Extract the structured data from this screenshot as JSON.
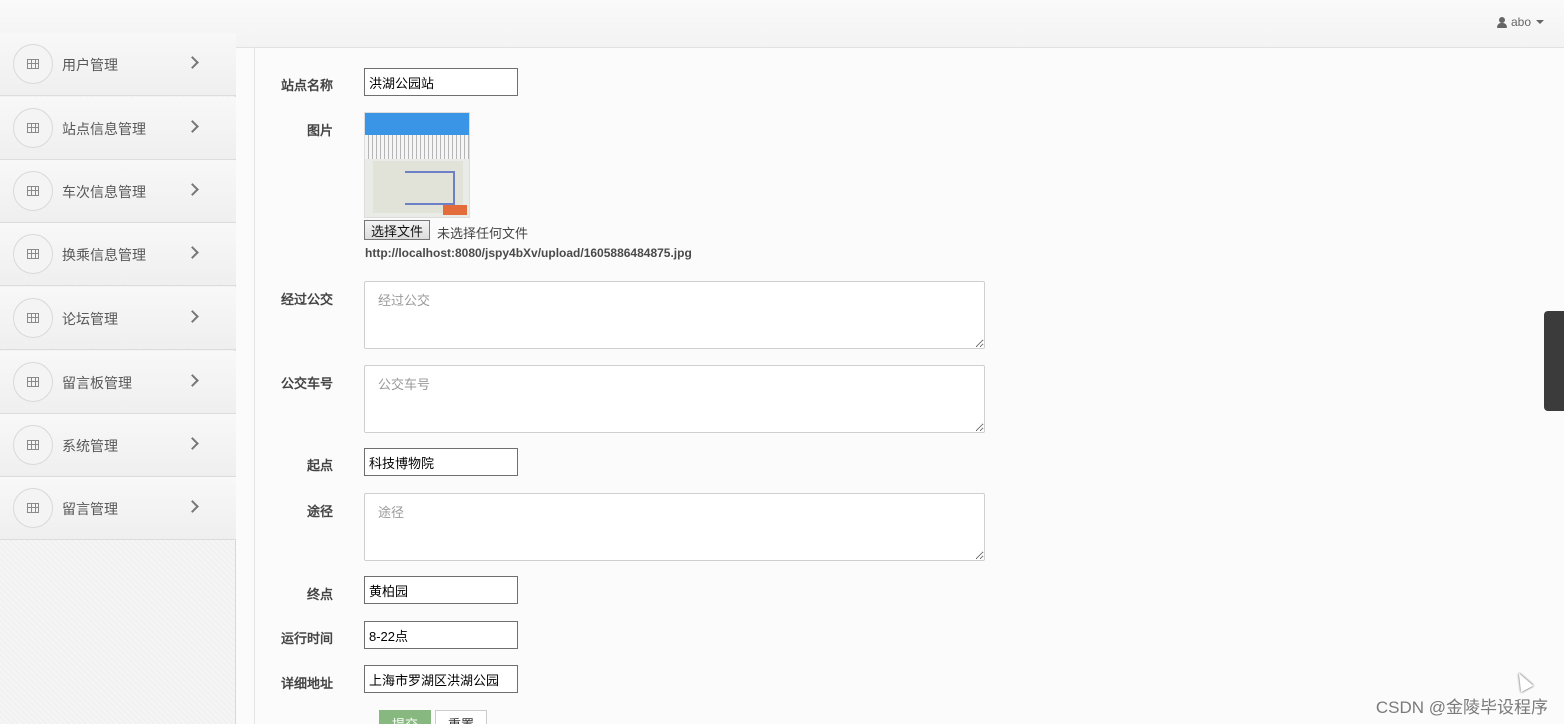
{
  "header": {
    "user": "abo"
  },
  "sidebar": {
    "items": [
      {
        "label": "用户管理"
      },
      {
        "label": "站点信息管理"
      },
      {
        "label": "车次信息管理"
      },
      {
        "label": "换乘信息管理"
      },
      {
        "label": "论坛管理"
      },
      {
        "label": "留言板管理"
      },
      {
        "label": "系统管理"
      },
      {
        "label": "留言管理"
      }
    ]
  },
  "form": {
    "station_name": {
      "label": "站点名称",
      "value": "洪湖公园站"
    },
    "image": {
      "label": "图片",
      "file_button": "选择文件",
      "file_status": "未选择任何文件",
      "url": "http://localhost:8080/jspy4bXv/upload/1605886484875.jpg"
    },
    "passing_bus": {
      "label": "经过公交",
      "placeholder": "经过公交"
    },
    "bus_number": {
      "label": "公交车号",
      "placeholder": "公交车号"
    },
    "start": {
      "label": "起点",
      "value": "科技博物院"
    },
    "route": {
      "label": "途径",
      "placeholder": "途径"
    },
    "end": {
      "label": "终点",
      "value": "黄柏园"
    },
    "run_time": {
      "label": "运行时间",
      "value": "8-22点"
    },
    "address": {
      "label": "详细地址",
      "value": "上海市罗湖区洪湖公园"
    },
    "submit": "提交",
    "reset": "重置"
  },
  "watermark": "CSDN @金陵毕设程序",
  "colors": {
    "submit_green": "#87b87f",
    "sidebar_bg": "#f2f2f2"
  }
}
